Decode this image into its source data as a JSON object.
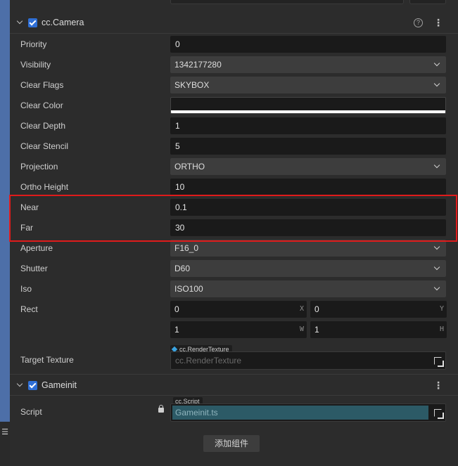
{
  "camera": {
    "title": "cc.Camera",
    "help_glyph": "?",
    "menu_glyph": "⋮",
    "props": {
      "priority": {
        "label": "Priority",
        "value": "0"
      },
      "visibility": {
        "label": "Visibility",
        "value": "1342177280"
      },
      "clear_flags": {
        "label": "Clear Flags",
        "value": "SKYBOX"
      },
      "clear_color": {
        "label": "Clear Color",
        "value": "#ffffff"
      },
      "clear_depth": {
        "label": "Clear Depth",
        "value": "1"
      },
      "clear_stencil": {
        "label": "Clear Stencil",
        "value": "5"
      },
      "projection": {
        "label": "Projection",
        "value": "ORTHO"
      },
      "ortho_height": {
        "label": "Ortho Height",
        "value": "10"
      },
      "near": {
        "label": "Near",
        "value": "0.1"
      },
      "far": {
        "label": "Far",
        "value": "30"
      },
      "aperture": {
        "label": "Aperture",
        "value": "F16_0"
      },
      "shutter": {
        "label": "Shutter",
        "value": "D60"
      },
      "iso": {
        "label": "Iso",
        "value": "ISO100"
      },
      "rect": {
        "label": "Rect",
        "x": "0",
        "y": "0",
        "w": "1",
        "h": "1",
        "x_axis": "X",
        "y_axis": "Y",
        "w_axis": "W",
        "h_axis": "H"
      },
      "target_texture": {
        "label": "Target Texture",
        "type_tag": "cc.RenderTexture",
        "placeholder": "cc.RenderTexture"
      }
    }
  },
  "gameinit": {
    "title": "Gameinit",
    "menu_glyph": "⋮",
    "script": {
      "label": "Script",
      "type_tag": "cc.Script",
      "value": "Gameinit.ts"
    }
  },
  "add_component_label": "添加组件",
  "side_menu_glyph": "☰",
  "colors": {
    "highlight": "#e01b1b",
    "checkbox": "#2f6fd6",
    "script_field": "#2c5a66"
  }
}
